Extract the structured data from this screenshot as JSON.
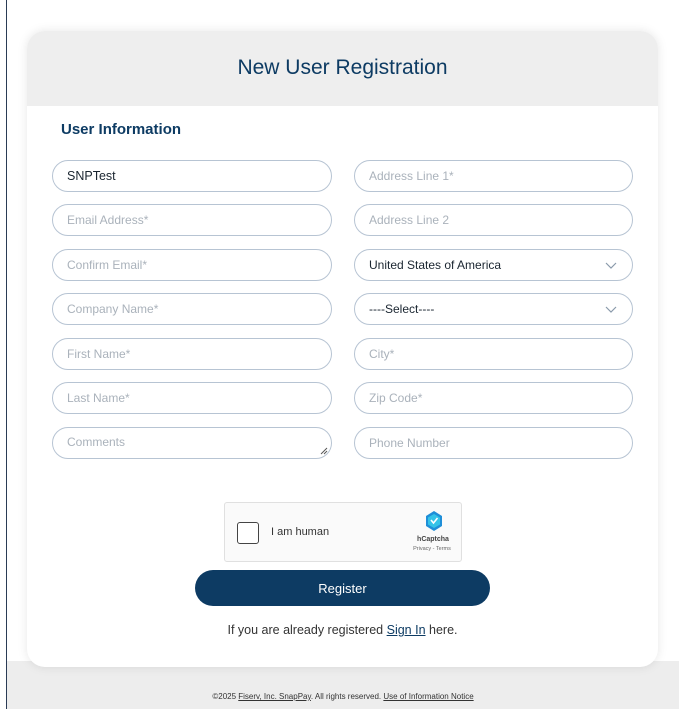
{
  "card": {
    "title": "New User Registration"
  },
  "section": {
    "title": "User Information"
  },
  "left_fields": {
    "username": {
      "value": "SNPTest"
    },
    "email": {
      "placeholder": "Email Address*"
    },
    "confirm_email": {
      "placeholder": "Confirm Email*"
    },
    "company": {
      "placeholder": "Company Name*"
    },
    "first_name": {
      "placeholder": "First Name*"
    },
    "last_name": {
      "placeholder": "Last Name*"
    },
    "comments": {
      "placeholder": "Comments"
    }
  },
  "right_fields": {
    "address1": {
      "placeholder": "Address Line 1*"
    },
    "address2": {
      "placeholder": "Address Line 2"
    },
    "country": {
      "value": "United States of America"
    },
    "state": {
      "value": "----Select----"
    },
    "city": {
      "placeholder": "City*"
    },
    "zip": {
      "placeholder": "Zip Code*"
    },
    "phone": {
      "placeholder": "Phone Number"
    }
  },
  "captcha": {
    "label": "I am human",
    "brand": "hCaptcha",
    "links": "Privacy - Terms"
  },
  "register": {
    "label": "Register"
  },
  "signin": {
    "prefix": "If you are already registered ",
    "link": "Sign In",
    "suffix": " here."
  },
  "footer": {
    "copyright_prefix": "©2025 ",
    "company_link": "Fiserv, Inc. SnapPay",
    "rights": ". All rights reserved. ",
    "notice_link": "Use of Information Notice"
  },
  "colors": {
    "primary": "#0d3b63",
    "header_bg": "#eeeeee",
    "border": "#b7c4d3"
  }
}
